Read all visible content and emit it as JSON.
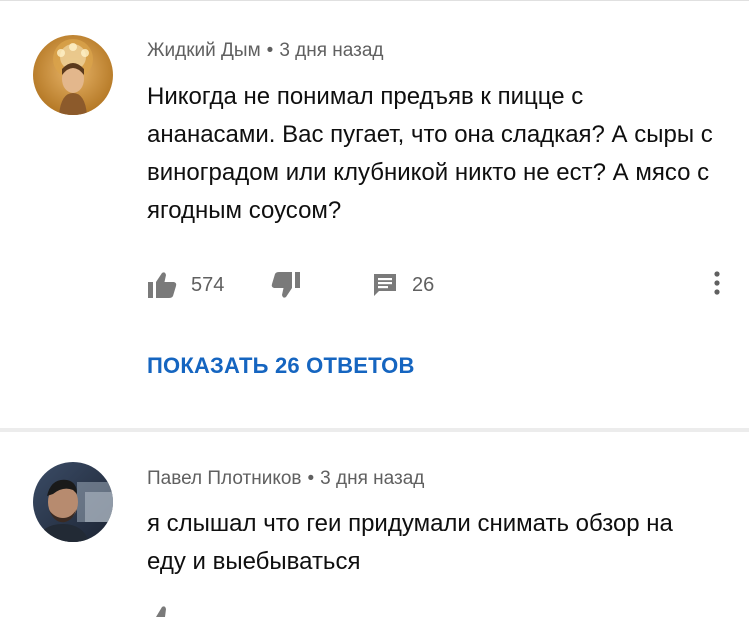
{
  "comments": [
    {
      "author": "Жидкий Дым",
      "separator": "•",
      "time": "3 дня назад",
      "text": "Никогда не понимал предъяв к пицце с ананасами. Вас пугает, что она сладкая? А сыры с виноградом или клубникой никто не ест? А мясо с ягодным соусом?",
      "likes": "574",
      "replies": "26",
      "show_replies_label": "ПОКАЗАТЬ 26 ОТВЕТОВ"
    },
    {
      "author": "Павел Плотников",
      "separator": "•",
      "time": "3 дня назад",
      "text": "я слышал что геи придумали снимать обзор на еду и выебываться"
    }
  ],
  "icons": [
    "thumb-up-icon",
    "thumb-down-icon",
    "reply-icon",
    "more-vert-icon"
  ],
  "colors": {
    "link": "#1565c0",
    "meta": "#606060",
    "text": "#0f0f0f",
    "divider": "#ececec"
  }
}
